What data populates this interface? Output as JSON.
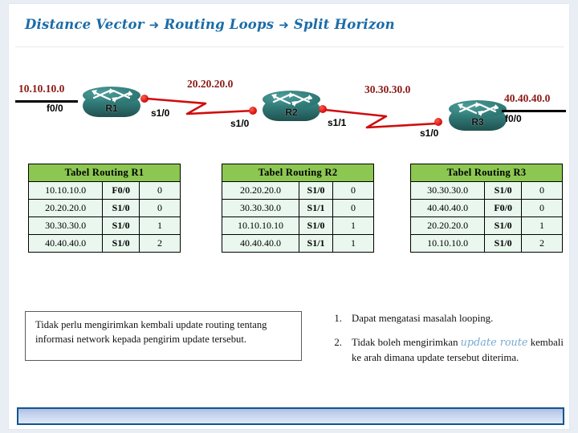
{
  "slide": {
    "title_parts": [
      "Distance Vector",
      "Routing Loops",
      "Split Horizon"
    ],
    "arrow_glyph": "➜"
  },
  "diagram": {
    "routers": [
      {
        "name": "R1"
      },
      {
        "name": "R2"
      },
      {
        "name": "R3"
      }
    ],
    "networks": [
      {
        "label": "10.10.10.0"
      },
      {
        "label": "20.20.20.0"
      },
      {
        "label": "30.30.30.0"
      },
      {
        "label": "40.40.40.0"
      }
    ],
    "interfaces": [
      {
        "label": "f0/0"
      },
      {
        "label": "s1/0"
      },
      {
        "label": "s1/0"
      },
      {
        "label": "s1/1"
      },
      {
        "label": "s1/0"
      },
      {
        "label": "f0/0"
      }
    ]
  },
  "tables": [
    {
      "title": "Tabel Routing R1",
      "rows": [
        {
          "network": "10.10.10.0",
          "interface": "F0/0",
          "metric": "0"
        },
        {
          "network": "20.20.20.0",
          "interface": "S1/0",
          "metric": "0"
        },
        {
          "network": "30.30.30.0",
          "interface": "S1/0",
          "metric": "1"
        },
        {
          "network": "40.40.40.0",
          "interface": "S1/0",
          "metric": "2"
        }
      ]
    },
    {
      "title": "Tabel Routing R2",
      "rows": [
        {
          "network": "20.20.20.0",
          "interface": "S1/0",
          "metric": "0"
        },
        {
          "network": "30.30.30.0",
          "interface": "S1/1",
          "metric": "0"
        },
        {
          "network": "10.10.10.10",
          "interface": "S1/0",
          "metric": "1"
        },
        {
          "network": "40.40.40.0",
          "interface": "S1/1",
          "metric": "1"
        }
      ]
    },
    {
      "title": "Tabel Routing R3",
      "rows": [
        {
          "network": "30.30.30.0",
          "interface": "S1/0",
          "metric": "0"
        },
        {
          "network": "40.40.40.0",
          "interface": "F0/0",
          "metric": "0"
        },
        {
          "network": "20.20.20.0",
          "interface": "S1/0",
          "metric": "1"
        },
        {
          "network": "10.10.10.0",
          "interface": "S1/0",
          "metric": "2"
        }
      ]
    }
  ],
  "note": {
    "text": "Tidak perlu mengirimkan kembali update routing tentang informasi network kepada pengirim update tersebut."
  },
  "points": [
    {
      "num": "1.",
      "before": "Dapat mengatasi masalah looping.",
      "highlight": "",
      "after": ""
    },
    {
      "num": "2.",
      "before": "Tidak boleh mengirimkan ",
      "highlight": "update route",
      "after": " kembali ke arah dimana update tersebut diterima."
    }
  ],
  "colors": {
    "title": "#1b6ca8",
    "network_label": "#8b1a15",
    "router_teal": "#2f7573",
    "link_red": "#cf0d0d",
    "table_header_green": "#8cc751",
    "table_cell": "#e9f7ee",
    "bottom_bar_border": "#12558c",
    "highlight_text": "#7aa9cf"
  }
}
